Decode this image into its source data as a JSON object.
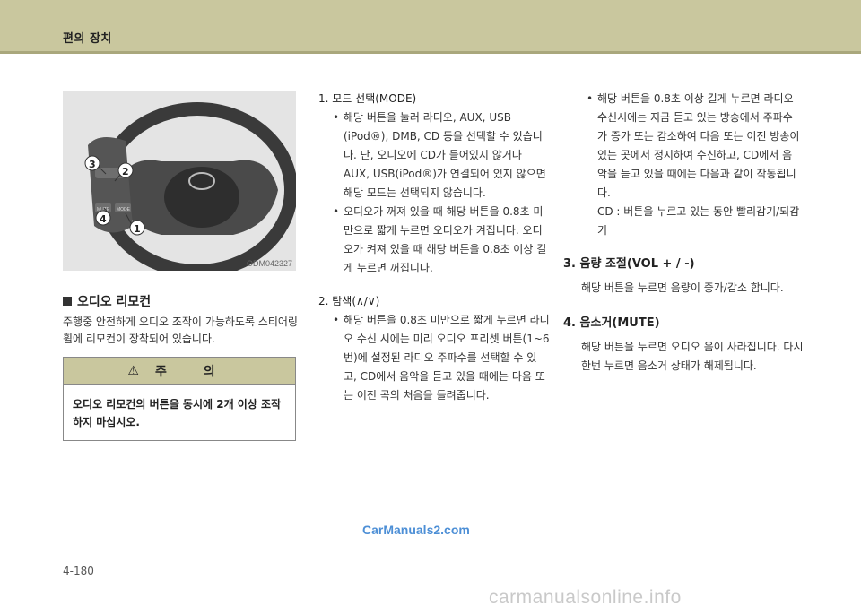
{
  "header": {
    "title": "편의 장치"
  },
  "figure": {
    "code": "ODM042327",
    "callouts": [
      "1",
      "2",
      "3",
      "4"
    ],
    "button_labels": [
      "MUTE",
      "MODE"
    ]
  },
  "section": {
    "heading": "오디오 리모컨",
    "body": "주행중 안전하게 오디오 조작이 가능하도록 스티어링 휠에 리모컨이 장착되어 있습니다."
  },
  "caution": {
    "icon": "warning-triangle-icon",
    "title": "주 의",
    "body": "오디오 리모컨의 버튼을 동시에 2개 이상 조작하지 마십시오."
  },
  "items": {
    "mode": {
      "title": "1. 모드 선택(MODE)",
      "bullet1": "해당 버튼을 눌러 라디오, AUX, USB (iPod®), DMB, CD 등을 선택할 수 있습니다. 단, 오디오에 CD가 들어있지 않거나 AUX, USB(iPod®)가 연결되어 있지 않으면 해당 모드는 선택되지 않습니다.",
      "bullet2": "오디오가 꺼져 있을 때 해당 버튼을 0.8초 미만으로 짧게 누르면 오디오가 켜집니다. 오디오가 켜져 있을 때 해당 버튼을 0.8초 이상 길게 누르면 꺼집니다."
    },
    "seek": {
      "title": "2. 탐색(∧/∨)",
      "bullet1": "해당 버튼을 0.8초 미만으로 짧게 누르면 라디오 수신 시에는 미리 오디오 프리셋 버튼(1~6번)에 설정된 라디오 주파수를 선택할 수 있고, CD에서 음악을 듣고 있을 때에는 다음 또는 이전 곡의 처음을 들려줍니다.",
      "bullet2": "해당 버튼을 0.8초 이상 길게 누르면 라디오 수신시에는 지금 듣고 있는 방송에서 주파수가 증가 또는 감소하여 다음 또는 이전 방송이 있는 곳에서 정지하여 수신하고, CD에서 음악을 듣고 있을 때에는 다음과 같이 작동됩니다.",
      "cd_note": "CD : 버튼을 누르고 있는 동안 빨리감기/되감기"
    },
    "volume": {
      "title": "3. 음량 조절(VOL + / -)",
      "body": "해당 버튼을 누르면 음량이 증가/감소 합니다."
    },
    "mute": {
      "title": "4. 음소거(MUTE)",
      "body": "해당 버튼을 누르면 오디오 음이 사라집니다. 다시 한번 누르면 음소거 상태가 해제됩니다."
    }
  },
  "watermark": "CarManuals2.com",
  "page_number": "4-180",
  "site_watermark": "carmanualsonline.info"
}
